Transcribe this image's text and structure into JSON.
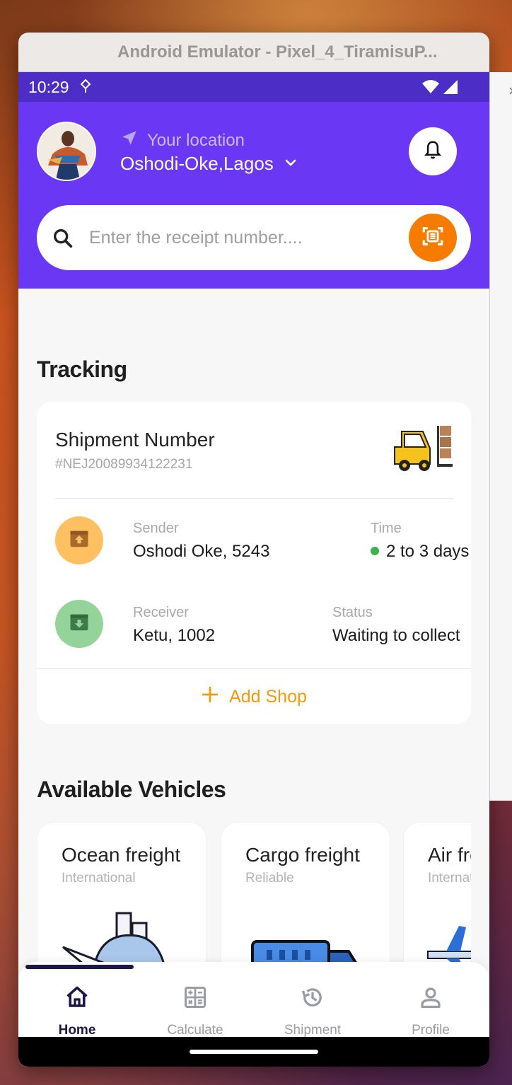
{
  "window": {
    "title": "Android Emulator - Pixel_4_TiramisuP..."
  },
  "status_bar": {
    "time": "10:29"
  },
  "header": {
    "location_label": "Your location",
    "location_value": "Oshodi-Oke,Lagos"
  },
  "search": {
    "placeholder": "Enter the receipt number...."
  },
  "tracking": {
    "title": "Tracking",
    "shipment_label": "Shipment Number",
    "shipment_number": "#NEJ20089934122231",
    "sender_label": "Sender",
    "sender_value": "Oshodi Oke, 5243",
    "time_label": "Time",
    "time_value": "2 to 3 days",
    "receiver_label": "Receiver",
    "receiver_value": "Ketu, 1002",
    "status_label": "Status",
    "status_value": "Waiting to collect",
    "add_shop_label": "Add Shop"
  },
  "vehicles": {
    "title": "Available Vehicles",
    "items": [
      {
        "title": "Ocean freight",
        "subtitle": "International"
      },
      {
        "title": "Cargo freight",
        "subtitle": "Reliable"
      },
      {
        "title": "Air freight",
        "subtitle": "International"
      }
    ]
  },
  "bottom_nav": {
    "items": [
      {
        "label": "Home",
        "icon": "home-icon",
        "active": true
      },
      {
        "label": "Calculate",
        "icon": "calculator-icon",
        "active": false
      },
      {
        "label": "Shipment",
        "icon": "history-icon",
        "active": false
      },
      {
        "label": "Profile",
        "icon": "person-icon",
        "active": false
      }
    ]
  },
  "colors": {
    "header": "#6a38f5",
    "status_bar": "#4c2ec6",
    "accent_orange": "#f57c00",
    "add_shop": "#f59a0a",
    "nav_active": "#1d1748"
  }
}
